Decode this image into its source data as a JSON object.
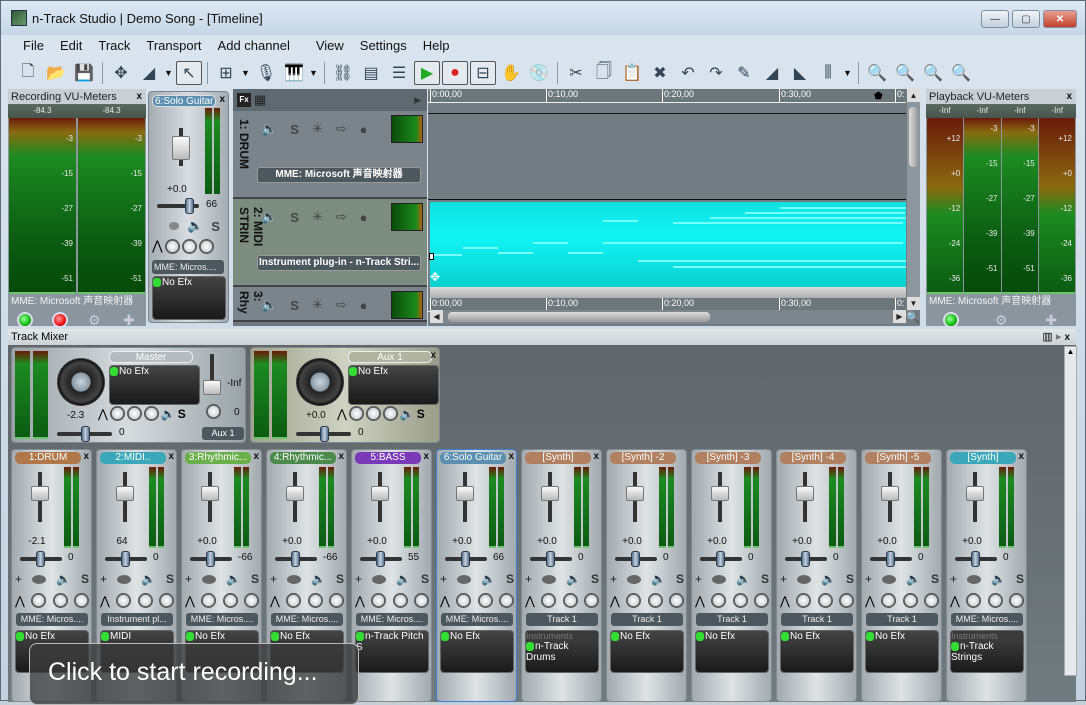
{
  "window": {
    "title": "n-Track Studio | Demo Song - [Timeline]",
    "minimize": "—",
    "maximize": "▢",
    "close": "✕"
  },
  "menu": [
    "File",
    "Edit",
    "Track",
    "Transport",
    "Add channel",
    "View",
    "Settings",
    "Help"
  ],
  "toolbar": [
    "new-file",
    "open-folder",
    "save",
    "nudge",
    "envelope-tool",
    "select-pointer",
    "grid-snap",
    "microphone",
    "piano-keyboard",
    "routing",
    "mixer",
    "piano-roll",
    "play-loop",
    "record-loop",
    "punch",
    "hand-tool",
    "cd-burn",
    "cut",
    "copy",
    "paste",
    "delete",
    "undo",
    "redo",
    "draw",
    "fade-in",
    "fade-out",
    "volume",
    "zoom-in-h",
    "zoom-out-h",
    "zoom-in-v",
    "zoom-out-v"
  ],
  "recording_vu": {
    "title": "Recording VU-Meters",
    "close": "x",
    "readouts": [
      "-84.3",
      "-84.3"
    ],
    "ticks": [
      "-3",
      "-15",
      "-27",
      "-39",
      "-51"
    ],
    "device": "MME: Microsoft 声音映射器"
  },
  "top_strip": {
    "name": "6:Solo Guitar",
    "vol": "+0.0",
    "pan": "66",
    "device": "MME: Micros....",
    "efx": "No Efx",
    "color": "#5b8fb0"
  },
  "tracks": {
    "fx_label": "Fx",
    "items": [
      {
        "name": "1: DRUM",
        "device": "MME: Microsoft 声音映射器"
      },
      {
        "name": "2: MIDI STRIN",
        "device": "Instrument plug-in - n-Track Stri..."
      },
      {
        "name": "3: Rhy",
        "device": ""
      }
    ]
  },
  "timeline": {
    "ruler": [
      "0:00,00",
      "0:10,00",
      "0:20,00",
      "0:30,00",
      "0:"
    ]
  },
  "playback_vu": {
    "title": "Playback VU-Meters",
    "close": "x",
    "readouts": [
      "-Inf",
      "-Inf",
      "-Inf",
      "-Inf"
    ],
    "outer_ticks": [
      "+12",
      "+0",
      "-12",
      "-24",
      "-36"
    ],
    "inner_ticks": [
      "-3",
      "-15",
      "-27",
      "-39",
      "-51"
    ],
    "device": "MME: Microsoft 声音映射器"
  },
  "mixer": {
    "title": "Track Mixer",
    "close": "x",
    "master": {
      "name": "Master",
      "efx": "No Efx",
      "vol": "-2.3",
      "pan": "0",
      "aux_level": "-Inf",
      "aux_send": "0",
      "aux_btn": "Aux 1"
    },
    "aux": {
      "name": "Aux 1",
      "efx": "No Efx",
      "vol": "+0.0",
      "pan": "0"
    },
    "channels": [
      {
        "name": "1:DRUM",
        "color": "#b07848",
        "vol": "-2.1",
        "pan": "0",
        "device": "MME: Micros....",
        "efx": "No Efx",
        "inst": "",
        "closable": true
      },
      {
        "name": "2:MIDI..",
        "color": "#3aa8b8",
        "vol": "64",
        "pan": "0",
        "device": "Instrument pl...",
        "efx": "MIDI",
        "inst": "",
        "closable": true
      },
      {
        "name": "3:Rhythmic...",
        "color": "#6ab04a",
        "vol": "+0.0",
        "pan": "-66",
        "device": "MME: Micros....",
        "efx": "No Efx",
        "inst": "",
        "closable": true
      },
      {
        "name": "4:Rhythmic...",
        "color": "#4a8a4a",
        "vol": "+0.0",
        "pan": "-66",
        "device": "MME: Micros....",
        "efx": "No Efx",
        "inst": "",
        "closable": true
      },
      {
        "name": "5:BASS",
        "color": "#7a3ab8",
        "vol": "+0.0",
        "pan": "55",
        "device": "MME: Micros....",
        "efx": "n-Track Pitch S",
        "inst": "",
        "closable": true
      },
      {
        "name": "6:Solo Guitar",
        "color": "#5b8fb0",
        "vol": "+0.0",
        "pan": "66",
        "device": "MME: Micros....",
        "efx": "No Efx",
        "inst": "",
        "closable": true
      },
      {
        "name": "[Synth]",
        "color": "#b08060",
        "vol": "+0.0",
        "pan": "0",
        "device": "Track 1",
        "efx": "n-Track Drums",
        "inst": "Instruments",
        "closable": true
      },
      {
        "name": "[Synth] -2",
        "color": "#b08060",
        "vol": "+0.0",
        "pan": "0",
        "device": "Track 1",
        "efx": "No Efx",
        "inst": "",
        "closable": false
      },
      {
        "name": "[Synth] -3",
        "color": "#b08060",
        "vol": "+0.0",
        "pan": "0",
        "device": "Track 1",
        "efx": "No Efx",
        "inst": "",
        "closable": false
      },
      {
        "name": "[Synth] -4",
        "color": "#b08060",
        "vol": "+0.0",
        "pan": "0",
        "device": "Track 1",
        "efx": "No Efx",
        "inst": "",
        "closable": false
      },
      {
        "name": "[Synth] -5",
        "color": "#b08060",
        "vol": "+0.0",
        "pan": "0",
        "device": "Track 1",
        "efx": "No Efx",
        "inst": "",
        "closable": false
      },
      {
        "name": "[Synth]",
        "color": "#3aa8b8",
        "vol": "+0.0",
        "pan": "0",
        "device": "MME: Micros....",
        "efx": "n-Track Strings",
        "inst": "Instruments",
        "closable": true
      }
    ]
  },
  "toast": "Click to start recording..."
}
